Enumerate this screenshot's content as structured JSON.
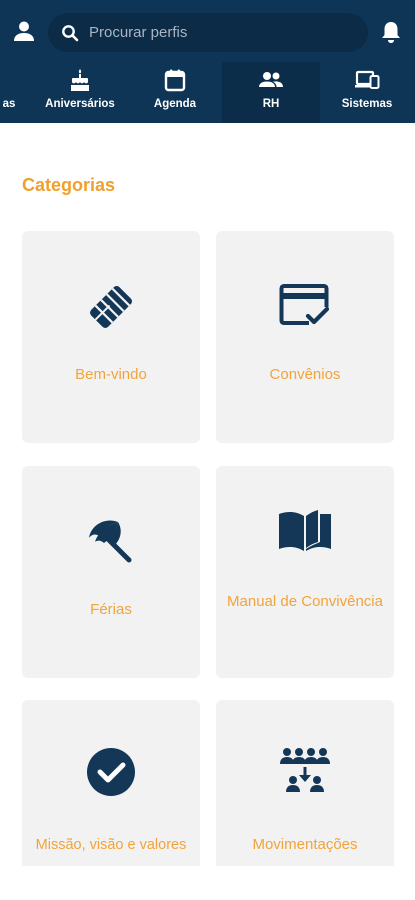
{
  "header": {
    "search": {
      "placeholder": "Procurar perfis"
    },
    "tabs": [
      {
        "label": "as",
        "icon": "partial-tab-icon"
      },
      {
        "label": "Aniversários",
        "icon": "birthday-cake-icon"
      },
      {
        "label": "Agenda",
        "icon": "calendar-icon"
      },
      {
        "label": "RH",
        "icon": "people-icon",
        "active": true
      },
      {
        "label": "Sistemas",
        "icon": "devices-icon"
      }
    ]
  },
  "main": {
    "section_title": "Categorias",
    "categories": [
      {
        "label": "Bem-vindo",
        "icon": "handshake-icon"
      },
      {
        "label": "Convênios",
        "icon": "credit-card-check-icon"
      },
      {
        "label": "Férias",
        "icon": "beach-umbrella-icon"
      },
      {
        "label": "Manual de Convivência",
        "icon": "open-book-icon"
      },
      {
        "label": "Missão, visão e valores",
        "icon": "check-circle-icon"
      },
      {
        "label": "Movimentações",
        "icon": "group-movement-icon"
      }
    ]
  },
  "colors": {
    "header_bg": "#0e3555",
    "accent": "#f0a02c",
    "icon": "#143757",
    "card_bg": "#f2f2f2"
  }
}
